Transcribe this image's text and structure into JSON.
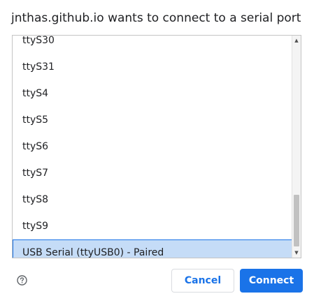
{
  "dialog": {
    "title": "jnthas.github.io wants to connect to a serial port"
  },
  "ports": [
    {
      "label": "ttyS30"
    },
    {
      "label": "ttyS31"
    },
    {
      "label": "ttyS4"
    },
    {
      "label": "ttyS5"
    },
    {
      "label": "ttyS6"
    },
    {
      "label": "ttyS7"
    },
    {
      "label": "ttyS8"
    },
    {
      "label": "ttyS9"
    },
    {
      "label": "USB Serial (ttyUSB0) - Paired"
    }
  ],
  "selected_port": "USB Serial (ttyUSB0) - Paired",
  "icons": {
    "help": "help-circle-icon",
    "scroll_up": "scroll-up-arrow-icon",
    "scroll_down": "scroll-down-arrow-icon"
  },
  "buttons": {
    "cancel_label": "Cancel",
    "connect_label": "Connect"
  },
  "colors": {
    "accent": "#1a73e8",
    "selected_row": "#c5dcf7"
  }
}
